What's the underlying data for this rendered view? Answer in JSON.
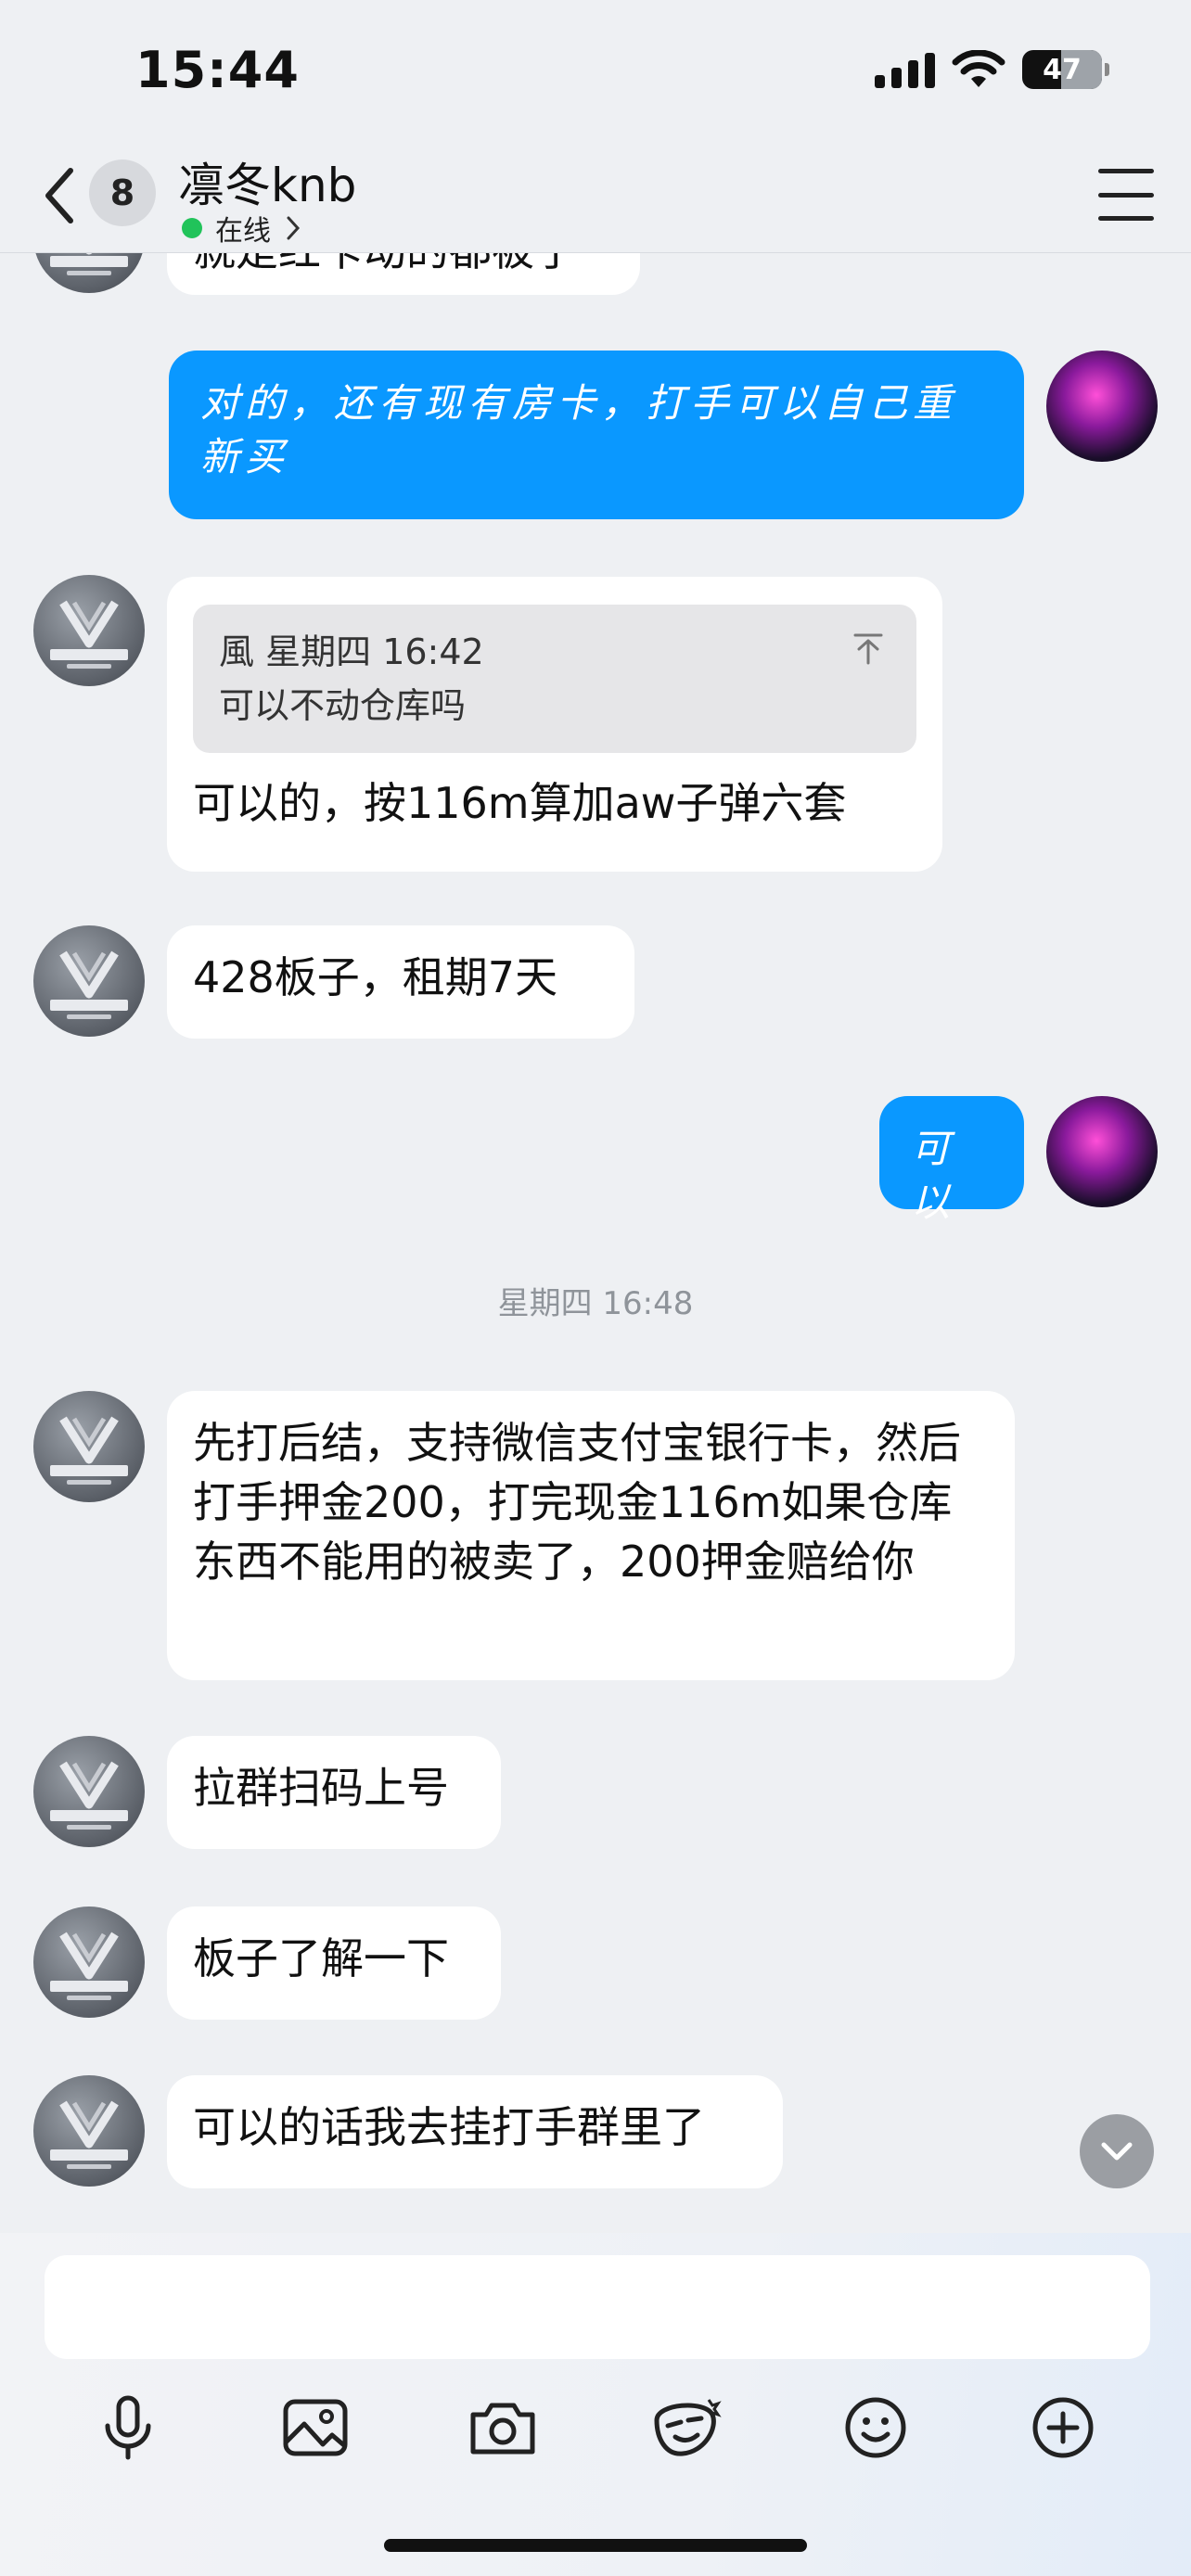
{
  "status_bar": {
    "time": "15:44",
    "battery": "47"
  },
  "header": {
    "unread_count": "8",
    "title": "凛冬knb",
    "presence": "在线"
  },
  "messages": [
    {
      "side": "in",
      "text": "就是红卡动的都被了"
    },
    {
      "side": "out",
      "text": "对的，还有现有房卡，打手可以自己重新买"
    },
    {
      "side": "in",
      "quote": {
        "sender": "風",
        "time": "星期四 16:42",
        "text": "可以不动仓库吗"
      },
      "text": "可以的，按116m算加aw子弹六套"
    },
    {
      "side": "in",
      "text": "428板子，租期7天"
    },
    {
      "side": "out",
      "text": "可以"
    },
    {
      "side": "in",
      "text": "先打后结，支持微信支付宝银行卡，然后打手押金200，打完现金116m如果仓库东西不能用的被卖了，200押金赔给你"
    },
    {
      "side": "in",
      "text": "拉群扫码上号"
    },
    {
      "side": "in",
      "text": "板子了解一下"
    },
    {
      "side": "in",
      "text": "可以的话我去挂打手群里了"
    }
  ],
  "timestamp_divider": "星期四 16:48",
  "input": {
    "placeholder": ""
  },
  "toolbar_icons": [
    "microphone-icon",
    "image-icon",
    "camera-icon",
    "sticker-icon",
    "emoji-icon",
    "plus-icon"
  ],
  "colors": {
    "outgoing_bubble": "#0a98ff",
    "online_dot": "#21c35a",
    "background": "#eef0f3"
  }
}
